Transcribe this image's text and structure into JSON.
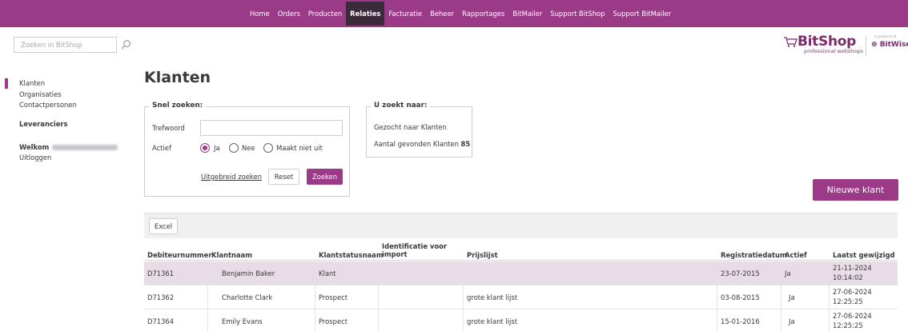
{
  "nav": {
    "items": [
      {
        "label": "Home"
      },
      {
        "label": "Orders"
      },
      {
        "label": "Producten"
      },
      {
        "label": "Relaties",
        "active": true
      },
      {
        "label": "Facturatie"
      },
      {
        "label": "Beheer"
      },
      {
        "label": "Rapportages"
      },
      {
        "label": "BitMailer"
      },
      {
        "label": "Support BitShop"
      },
      {
        "label": "Support BitMailer"
      }
    ]
  },
  "search": {
    "placeholder": "Zoeken in BitShop",
    "icon": "search-icon"
  },
  "logo": {
    "brand": "BitShop",
    "tagline": "professional webshops",
    "product_of": "a product of",
    "company": "BitWise"
  },
  "sidebar": {
    "klanten": "Klanten",
    "organisaties": "Organisaties",
    "contactpersonen": "Contactpersonen",
    "leveranciers": "Leveranciers",
    "welkom": "Welkom",
    "uitloggen": "Uitloggen"
  },
  "page_title": "Klanten",
  "quick_search": {
    "legend": "Snel zoeken:",
    "trefwoord_label": "Trefwoord",
    "trefwoord_value": "",
    "actief_label": "Actief",
    "options": [
      "Ja",
      "Nee",
      "Maakt niet uit"
    ],
    "selected": "Ja",
    "advanced_link": "Uitgebreid zoeken",
    "reset": "Reset",
    "search": "Zoeken"
  },
  "results": {
    "legend": "U zoekt naar:",
    "searched": "Gezocht naar Klanten",
    "count_label": "Aantal gevonden Klanten",
    "count": "85"
  },
  "new_button": "Nieuwe klant",
  "table": {
    "excel": "Excel",
    "headers": [
      "Debiteurnummer",
      "Klantnaam",
      "Klantstatusnaam",
      "Identificatie voor import",
      "Prijslijst",
      "Registratiedatum",
      "Actief",
      "Laatst gewijzigd"
    ],
    "rows": [
      {
        "debiteur": "D71361",
        "naam": "Benjamin Baker",
        "status": "Klant",
        "import": "",
        "prijslijst": "",
        "registratie": "23-07-2015",
        "actief": "Ja",
        "gewijzigd_date": "21-11-2024",
        "gewijzigd_time": "10:14:02"
      },
      {
        "debiteur": "D71362",
        "naam": "Charlotte Clark",
        "status": "Prospect",
        "import": "",
        "prijslijst": "grote klant lijst",
        "registratie": "03-08-2015",
        "actief": "Ja",
        "gewijzigd_date": "27-06-2024",
        "gewijzigd_time": "12:25:25"
      },
      {
        "debiteur": "D71364",
        "naam": "Emily Evans",
        "status": "Prospect",
        "import": "",
        "prijslijst": "grote klant lijst",
        "registratie": "15-01-2016",
        "actief": "Ja",
        "gewijzigd_date": "27-06-2024",
        "gewijzigd_time": "12:25:25"
      }
    ]
  },
  "colors": {
    "accent": "#9b3a86",
    "active_nav": "#3a2a3a",
    "row_highlight": "#e8dce6"
  }
}
